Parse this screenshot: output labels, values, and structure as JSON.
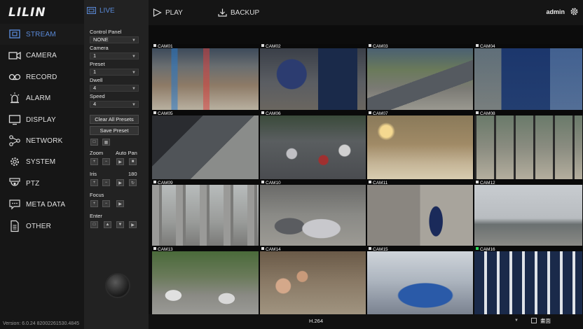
{
  "brand": {
    "logo": "LILIN"
  },
  "sidebar": {
    "items": [
      {
        "label": "STREAM",
        "icon": "stream-icon",
        "active": true
      },
      {
        "label": "CAMERA",
        "icon": "camera-icon"
      },
      {
        "label": "RECORD",
        "icon": "record-icon"
      },
      {
        "label": "ALARM",
        "icon": "alarm-icon"
      },
      {
        "label": "DISPLAY",
        "icon": "display-icon"
      },
      {
        "label": "NETWORK",
        "icon": "network-icon"
      },
      {
        "label": "SYSTEM",
        "icon": "system-icon"
      },
      {
        "label": "PTZ",
        "icon": "ptz-icon"
      },
      {
        "label": "META DATA",
        "icon": "meta-data-icon"
      },
      {
        "label": "OTHER",
        "icon": "other-icon"
      }
    ],
    "version": "Version: 6.0.24 82002261530.4845"
  },
  "tabs": {
    "live": "LIVE",
    "play": "PLAY",
    "backup": "BACKUP"
  },
  "ptz": {
    "control_panel_label": "Control Panel",
    "control_panel_value": "NONE",
    "camera_label": "Camera",
    "camera_value": "1",
    "preset_label": "Preset",
    "preset_value": "1",
    "dwell_label": "Dwell",
    "dwell_value": "4",
    "speed_label": "Speed",
    "speed_value": "4",
    "clear_presets": "Clear All Presets",
    "save_preset": "Save Preset",
    "zoom_label": "Zoom",
    "auto_pan_label": "Auto Pan",
    "iris_label": "Iris",
    "iris_180_label": "180",
    "focus_label": "Focus",
    "enter_label": "Enter"
  },
  "user": {
    "name": "admin"
  },
  "cameras": [
    "CAM01",
    "CAM02",
    "CAM03",
    "CAM04",
    "CAM05",
    "CAM06",
    "CAM07",
    "CAM08",
    "CAM09",
    "CAM10",
    "CAM11",
    "CAM12",
    "CAM13",
    "CAM14",
    "CAM15",
    "CAM16"
  ],
  "camera_selected": "CAM16",
  "bottom": {
    "codec": "H.264",
    "layout_label": "畫面"
  },
  "colors": {
    "accent": "#5a8ad8",
    "selected_camera": "#2ddb5a"
  }
}
